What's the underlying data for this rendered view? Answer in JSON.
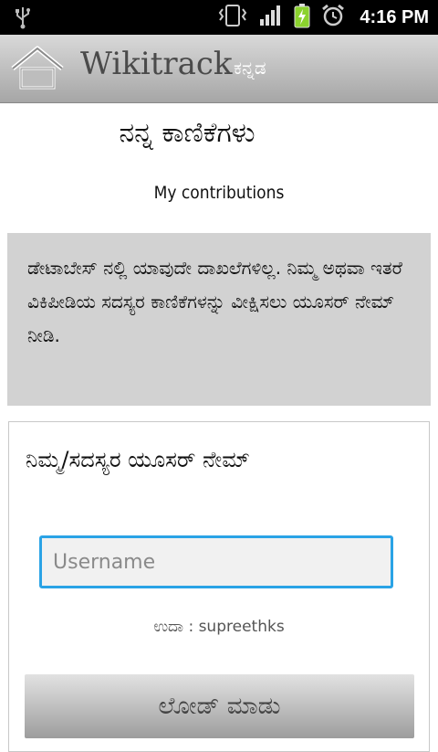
{
  "status_bar": {
    "icons": [
      "usb-icon",
      "vibrate-icon",
      "signal-icon",
      "battery-charging-icon",
      "alarm-icon"
    ],
    "time": "4:16 PM"
  },
  "app_bar": {
    "home_icon": "home-icon",
    "title": "Wikitrack",
    "language": "ಕನ್ನಡ"
  },
  "page": {
    "title": "ನನ್ನ ಕಾಣಿಕೆಗಳು",
    "subtitle": "My contributions",
    "info_message": "ಡೇಟಾಬೇಸ್ ನಲ್ಲಿ ಯಾವುದೇ ದಾಖಲೆಗಳಿಲ್ಲ. ನಿಮ್ಮ ಅಥವಾ ಇತರೆ ವಿಕಿಪೀಡಿಯ ಸದಸ್ಯರ ಕಾಣಿಕೆಗಳನ್ನು ವೀಕ್ಷಿಸಲು ಯೂಸರ್ ನೇಮ್ ನೀಡಿ."
  },
  "form": {
    "label": "ನಿಮ್ಮ/ಸದಸ್ಯರ ಯೂಸರ್ ನೇಮ್",
    "username_value": "",
    "username_placeholder": "Username",
    "example": "ಉದಾ : supreethks",
    "load_button": "ಲೋಡ್ ಮಾಡು"
  },
  "colors": {
    "input_focus": "#2aa3e6",
    "info_bg": "#d2d2d2",
    "battery": "#8bd22e"
  }
}
